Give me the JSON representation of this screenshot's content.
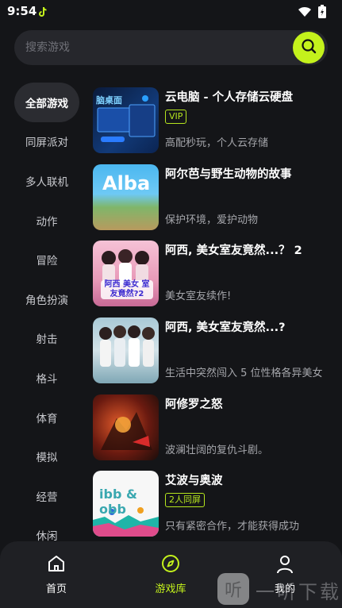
{
  "status_bar": {
    "time": "9:54"
  },
  "search": {
    "placeholder": "搜索游戏",
    "accent": "#c4f21c"
  },
  "categories": [
    "全部游戏",
    "同屏派对",
    "多人联机",
    "动作",
    "冒险",
    "角色扮演",
    "射击",
    "格斗",
    "体育",
    "模拟",
    "经营",
    "休闲"
  ],
  "active_category": "全部游戏",
  "games": [
    {
      "title": "云电脑 - 个人存储云硬盘",
      "tag": "VIP",
      "description": "高配秒玩，个人云存储",
      "thumb_text": "脑桌面"
    },
    {
      "title": "阿尔芭与野生动物的故事",
      "tag": "",
      "description": "保护环境，爱护动物",
      "thumb_text": "Alba"
    },
    {
      "title": "阿西, 美女室友竟然...？ 2",
      "tag": "",
      "description": "美女室友续作!",
      "thumb_text": "阿西 美女 室友竟然?2"
    },
    {
      "title": "阿西, 美女室友竟然...?",
      "tag": "",
      "description": "生活中突然闯入 5 位性格各异美女",
      "thumb_text": ""
    },
    {
      "title": "阿修罗之怒",
      "tag": "",
      "description": "波澜壮阔的复仇斗剧。",
      "thumb_text": ""
    },
    {
      "title": "艾波与奥波",
      "tag": "2人同屏",
      "description": "只有紧密合作，才能获得成功",
      "thumb_text": "ibb & obb"
    },
    {
      "title": "",
      "tag": "",
      "description": "",
      "thumb_text": ""
    }
  ],
  "bottom_nav": [
    {
      "label": "首页",
      "icon": "home-icon"
    },
    {
      "label": "游戏库",
      "icon": "compass-icon"
    },
    {
      "label": "我的",
      "icon": "profile-icon"
    }
  ],
  "active_nav": "游戏库",
  "watermark": "一听下载"
}
